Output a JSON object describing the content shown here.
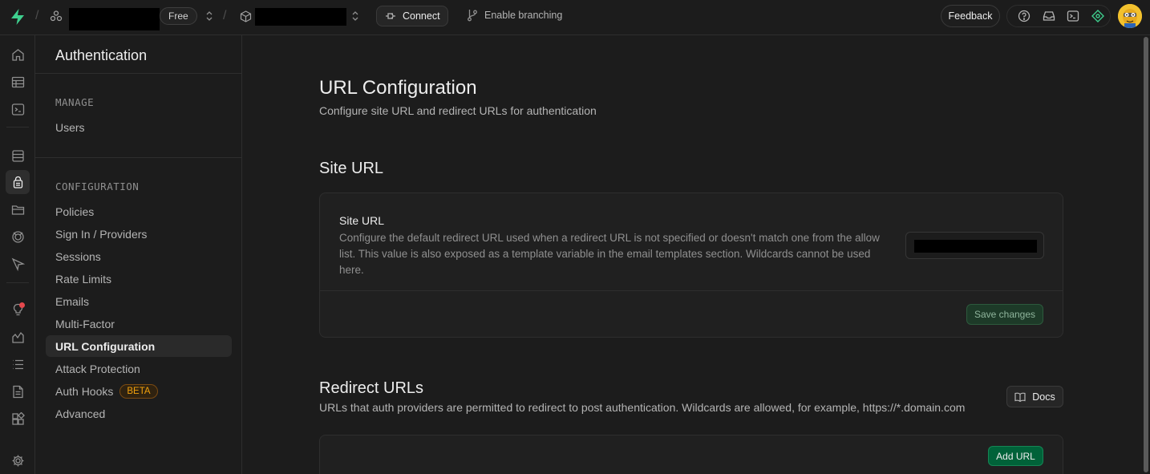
{
  "topbar": {
    "plan_badge": "Free",
    "connect_label": "Connect",
    "branching_label": "Enable branching",
    "feedback_label": "Feedback"
  },
  "sidebar": {
    "title": "Authentication",
    "manage_heading": "MANAGE",
    "manage_items": [
      {
        "label": "Users"
      }
    ],
    "config_heading": "CONFIGURATION",
    "config_items": [
      {
        "label": "Policies"
      },
      {
        "label": "Sign In / Providers"
      },
      {
        "label": "Sessions"
      },
      {
        "label": "Rate Limits"
      },
      {
        "label": "Emails"
      },
      {
        "label": "Multi-Factor"
      },
      {
        "label": "URL Configuration",
        "active": true
      },
      {
        "label": "Attack Protection"
      },
      {
        "label": "Auth Hooks",
        "badge": "BETA"
      },
      {
        "label": "Advanced"
      }
    ]
  },
  "main": {
    "title": "URL Configuration",
    "subtitle": "Configure site URL and redirect URLs for authentication",
    "site_url": {
      "section_title": "Site URL",
      "field_label": "Site URL",
      "field_description": "Configure the default redirect URL used when a redirect URL is not specified or doesn't match one from the allow list. This value is also exposed as a template variable in the email templates section. Wildcards cannot be used here.",
      "save_label": "Save changes"
    },
    "redirect_urls": {
      "section_title": "Redirect URLs",
      "description": "URLs that auth providers are permitted to redirect to post authentication. Wildcards are allowed, for example, https://*.domain.com",
      "docs_label": "Docs",
      "add_label": "Add URL"
    }
  },
  "colors": {
    "accent": "#3ecf8e",
    "background": "#1c1c1c",
    "border": "#2e2e2e",
    "beta_badge": "#f1a10d",
    "notification_dot": "#e5484d"
  },
  "icons": {
    "rail": [
      "home-icon",
      "table-editor-icon",
      "sql-editor-icon",
      "database-icon",
      "auth-icon",
      "storage-icon",
      "realtime-icon",
      "edge-functions-icon",
      "advisors-icon",
      "reports-icon",
      "logs-icon",
      "api-docs-icon",
      "integrations-icon",
      "settings-icon"
    ]
  }
}
